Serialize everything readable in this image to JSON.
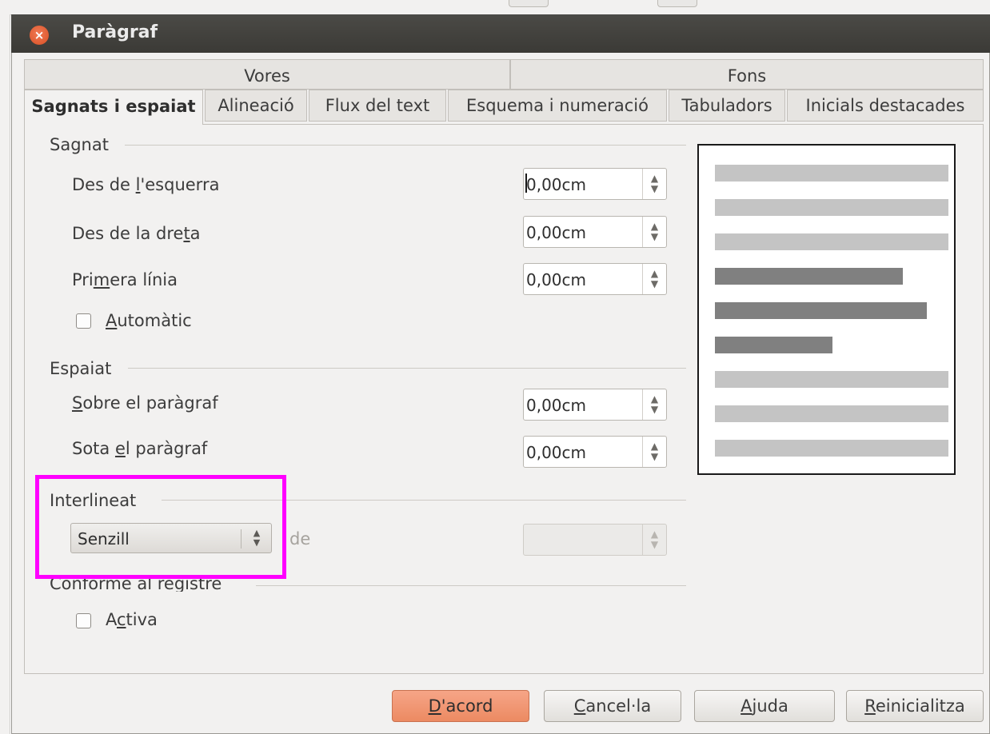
{
  "dialog": {
    "title": "Paràgraf"
  },
  "tabs": {
    "row1": [
      "Vores",
      "Fons"
    ],
    "row2": [
      "Sagnats i espaiat",
      "Alineació",
      "Flux del text",
      "Esquema i numeració",
      "Tabuladors",
      "Inicials destacades"
    ],
    "active": "Sagnats i espaiat"
  },
  "sagnat": {
    "heading": "Sagnat",
    "from_left": {
      "label_pre": "Des de ",
      "label_u": "l",
      "label_post": "'esquerra",
      "value": "0,00cm"
    },
    "from_right": {
      "label_pre": "Des de la dre",
      "label_u": "t",
      "label_post": "a",
      "value": "0,00cm"
    },
    "first_line": {
      "label_pre": "Pri",
      "label_u": "m",
      "label_post": "era línia",
      "value": "0,00cm"
    },
    "automatic": {
      "label_u": "A",
      "label_post": "utomàtic",
      "checked": false
    }
  },
  "espaiat": {
    "heading": "Espaiat",
    "above": {
      "label_u": "S",
      "label_post": "obre el paràgraf",
      "value": "0,00cm"
    },
    "below": {
      "label_pre": "Sota ",
      "label_u": "e",
      "label_post": "l paràgraf",
      "value": "0,00cm"
    }
  },
  "interlineat": {
    "heading": "Interlineat",
    "selected": "Senzill",
    "of_label": "de",
    "of_value": ""
  },
  "register": {
    "heading": "Conforme al registre",
    "activate": {
      "label_pre": "A",
      "label_u": "c",
      "label_post": "tiva",
      "checked": false
    }
  },
  "buttons": {
    "ok": {
      "u": "D",
      "rest": "'acord"
    },
    "cancel": {
      "u": "C",
      "rest": "ancel·la"
    },
    "help": {
      "u": "A",
      "rest": "juda"
    },
    "reset": {
      "u": "R",
      "rest": "einicialitza"
    }
  },
  "colors": {
    "highlight": "#ff00ff",
    "ok_button": "#ec8a62",
    "titlebar": "#3b3a36",
    "preview_light": "#c4c4c4",
    "preview_dark": "#808080"
  }
}
